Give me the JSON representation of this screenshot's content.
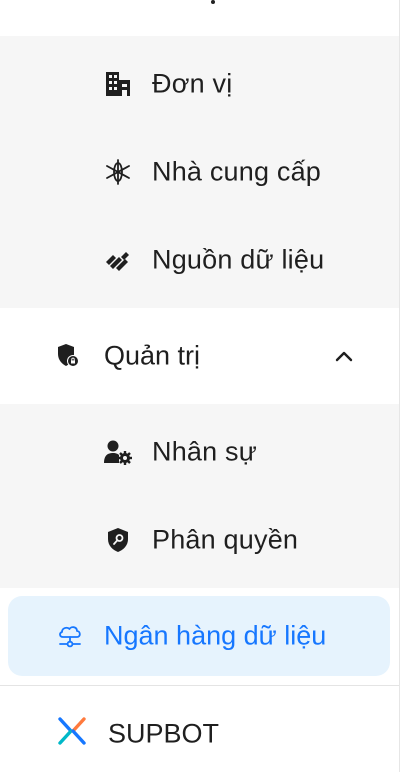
{
  "menu": {
    "data_group_items": [
      {
        "label": "Đơn vị",
        "icon": "building-icon"
      },
      {
        "label": "Nhà cung cấp",
        "icon": "asterisk-icon"
      },
      {
        "label": "Nguồn dữ liệu",
        "icon": "stripes-icon"
      }
    ],
    "admin": {
      "label": "Quản trị",
      "icon": "shield-lock-icon",
      "expanded": true,
      "items": [
        {
          "label": "Nhân sự",
          "icon": "user-gear-icon"
        },
        {
          "label": "Phân quyền",
          "icon": "shield-key-icon"
        }
      ]
    },
    "active_item": {
      "label": "Ngân hàng dữ liệu",
      "icon": "cloud-network-icon"
    },
    "bottom_item": {
      "label": "SUPBOT",
      "icon": "supbot-logo-icon"
    }
  },
  "colors": {
    "active_background": "#e6f3fd",
    "active_text": "#1677ff",
    "submenu_background": "#f6f6f6",
    "logo_blue": "#1677ff",
    "logo_teal": "#00b8c8",
    "logo_orange": "#ff7a3d"
  }
}
